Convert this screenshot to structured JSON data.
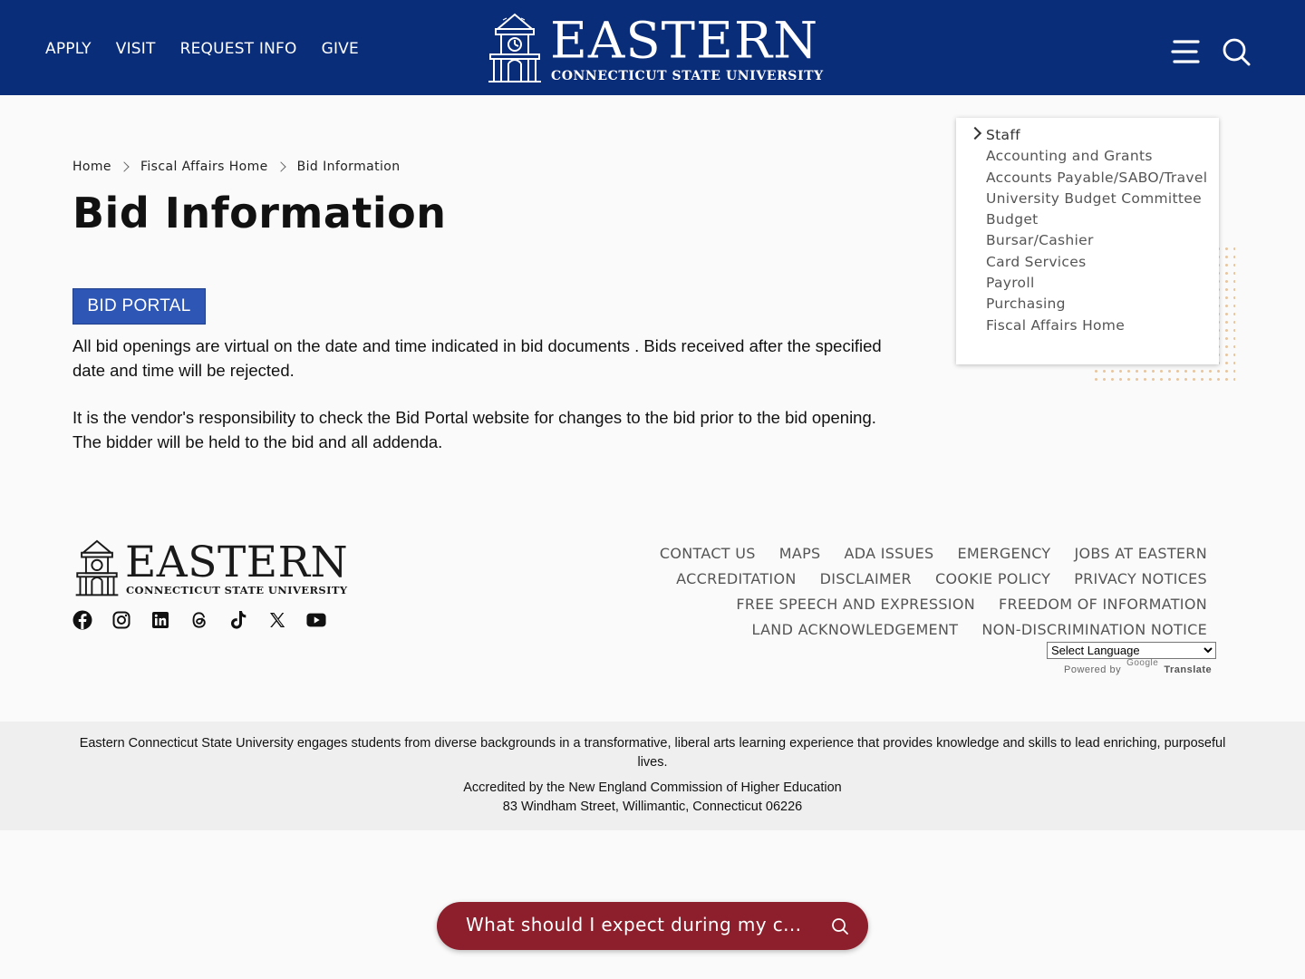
{
  "header": {
    "nav": [
      "APPLY",
      "VISIT",
      "REQUEST INFO",
      "GIVE"
    ],
    "logo_word": "EASTERN",
    "logo_sub": "CONNECTICUT STATE UNIVERSITY",
    "menu_icon": "hamburger-menu-icon",
    "search_icon": "search-icon",
    "bg_color": "#0a2d7a"
  },
  "breadcrumb": [
    "Home",
    "Fiscal Affairs Home",
    "Bid Information"
  ],
  "page_title": "Bid Information",
  "bid_portal_label": "BID PORTAL",
  "paragraphs": [
    "All bid openings are virtual on the date and time indicated in bid documents . Bids received after the specified date and time will be rejected.",
    "It is the vendor's responsibility to check the Bid Portal website for changes to the bid prior to the bid opening. The bidder will be held to the bid and all addenda."
  ],
  "sidebar": {
    "items": [
      "Staff",
      "Accounting and Grants",
      "Accounts Payable/SABO/Travel",
      "University Budget Committee",
      "Budget",
      "Bursar/Cashier",
      "Card Services",
      "Payroll",
      "Purchasing",
      "Fiscal Affairs Home"
    ]
  },
  "footer": {
    "logo_word": "EASTERN",
    "logo_sub": "CONNECTICUT STATE UNIVERSITY",
    "social_icons": [
      "facebook-icon",
      "instagram-icon",
      "linkedin-icon",
      "threads-icon",
      "tiktok-icon",
      "x-icon",
      "youtube-icon"
    ],
    "links_rows": [
      [
        "CONTACT US",
        "MAPS",
        "ADA ISSUES",
        "EMERGENCY",
        "JOBS AT EASTERN"
      ],
      [
        "ACCREDITATION",
        "DISCLAIMER",
        "COOKIE POLICY",
        "PRIVACY NOTICES"
      ],
      [
        "FREE SPEECH AND EXPRESSION",
        "FREEDOM OF INFORMATION"
      ],
      [
        "LAND ACKNOWLEDGEMENT",
        "NON-DISCRIMINATION NOTICE"
      ]
    ],
    "language_select": "Select Language",
    "powered_by": "Powered by",
    "google": "Google",
    "translate": "Translate",
    "mission": "Eastern Connecticut State University engages students from diverse backgrounds in a transformative, liberal arts learning experience that provides knowledge and skills to lead enriching, purposeful lives.",
    "accreditation": "Accredited by the New England Commission of Higher Education",
    "address": "83 Windham Street, Willimantic, Connecticut 06226"
  },
  "ask_bar": {
    "text": "What should I expect during my c...",
    "color": "#8c1f2b"
  }
}
